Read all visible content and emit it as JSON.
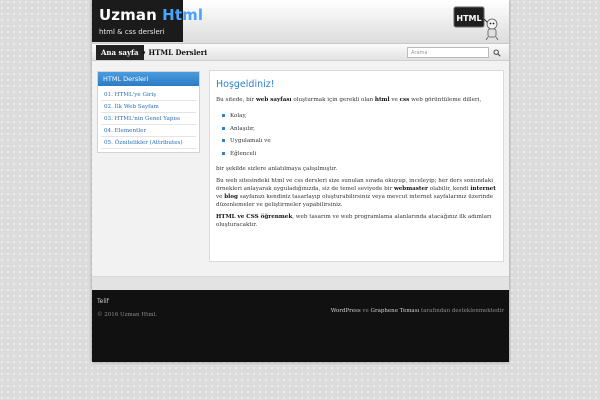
{
  "header": {
    "title_part1": "Uzman",
    "title_part2": "Html",
    "tagline": "html & css dersleri",
    "logo_text": "HTML"
  },
  "nav": {
    "home": "Ana sayfa",
    "html_dersleri": "HTML Dersleri",
    "search_placeholder": "Arama"
  },
  "sidebar": {
    "title": "HTML Dersleri",
    "items": [
      {
        "label": "01. HTML'ye Giriş"
      },
      {
        "label": "02. İlk Web Sayfam"
      },
      {
        "label": "03. HTML'nin Genel Yapısı"
      },
      {
        "label": "04. Elementler"
      },
      {
        "label": "05. Öznitelikler (Attributes)"
      }
    ]
  },
  "main": {
    "heading": "Hoşgeldiniz!",
    "intro_a": "Bu sitede, bir ",
    "intro_b": "web sayfası",
    "intro_c": " oluşturmak için gerekli olan ",
    "intro_d": "html",
    "intro_e": " ve ",
    "intro_f": "css",
    "intro_g": " web görüntülemе dilleri,",
    "list": [
      "Kolay,",
      "Anlaşılır,",
      "Uygulamalı ve",
      "Eğlenceli"
    ],
    "after_list": "bir şekilde sizlere anlatılmaya çalışılmıştır.",
    "p2_a": "Bu web sitesindeki html ve css dersleri size sunulan sırada okuyup, inceleyip; her ders sonundaki örnekleri anlayarak uyguladığınızda, siz de temel seviyede bir ",
    "p2_b": "webmaster",
    "p2_c": " olabilir, kendi ",
    "p2_d": "internet",
    "p2_e": " ve ",
    "p2_f": "blog",
    "p2_g": " sayfanızı kendiniz tasarlayıp oluşturabilirsiniz veya mevcut internet sayfalarınız üzerinde düzenlemeler ve geliştirmeler yapabilirsiniz.",
    "p3_a": "HTML ve CSS öğrenmek",
    "p3_b": ", web tasarım ve web programlama alanlarında atacağınız ilk adımları oluşturacaktır."
  },
  "footer": {
    "widget_title": "Telif",
    "copyright": "© 2016 Uzman Html.",
    "wordpress": "WordPress",
    "ve": " ve ",
    "theme": "Graphene Teması",
    "suffix": " tarafından desteklenmektedir"
  }
}
